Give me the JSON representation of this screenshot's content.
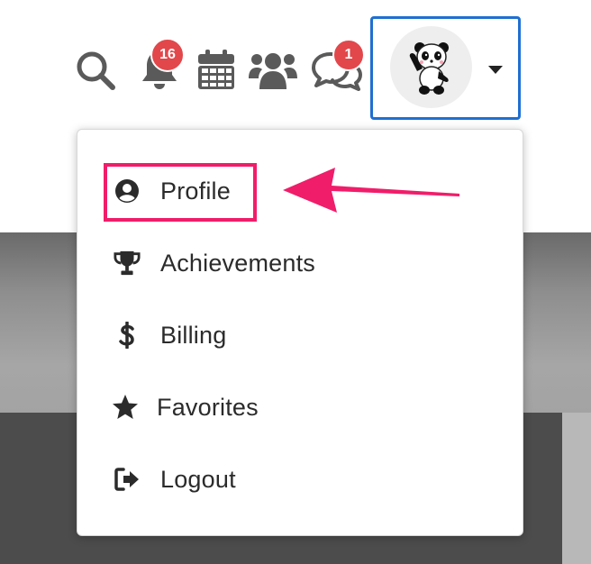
{
  "toolbar": {
    "icons": [
      "search-icon",
      "bell-icon",
      "calendar-icon",
      "users-icon",
      "chat-icon"
    ],
    "notifications_badge": "16",
    "messages_badge": "1",
    "avatar_icon": "panda-avatar",
    "caret_icon": "caret-down-icon"
  },
  "menu": {
    "items": [
      {
        "label": "Profile",
        "icon": "user-circle-icon"
      },
      {
        "label": "Achievements",
        "icon": "trophy-icon"
      },
      {
        "label": "Billing",
        "icon": "dollar-icon"
      },
      {
        "label": "Favorites",
        "icon": "star-icon"
      },
      {
        "label": "Logout",
        "icon": "logout-icon"
      }
    ]
  },
  "colors": {
    "badge": "#e2474b",
    "avatar_border": "#1f6fd1",
    "highlight": "#f01d6a",
    "icon": "#5a5a5a",
    "menu_text": "#2b2b2b"
  }
}
